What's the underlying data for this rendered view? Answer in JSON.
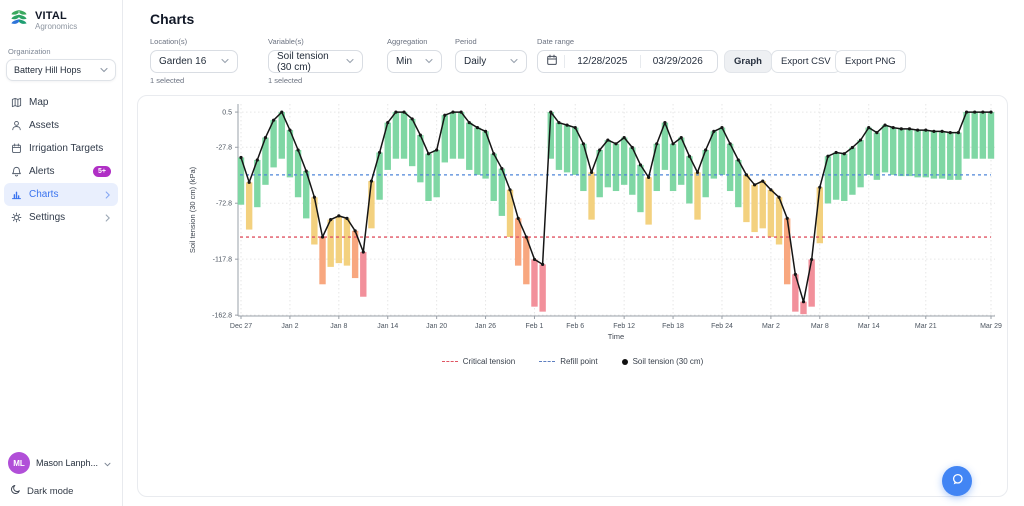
{
  "sidebar": {
    "brand": {
      "name": "VITAL",
      "tagline": "Agronomics"
    },
    "organization": {
      "label": "Organization",
      "selected": "Battery Hill Hops"
    },
    "nav": [
      {
        "label": "Map",
        "icon": "map-icon"
      },
      {
        "label": "Assets",
        "icon": "user-icon"
      },
      {
        "label": "Irrigation Targets",
        "icon": "calendar-icon"
      },
      {
        "label": "Alerts",
        "icon": "bell-icon",
        "badge": "5+"
      },
      {
        "label": "Charts",
        "icon": "bar-chart-icon",
        "active": true
      },
      {
        "label": "Settings",
        "icon": "gear-icon"
      }
    ],
    "user": {
      "initials": "ML",
      "name": "Mason Lanph..."
    },
    "dark_mode_label": "Dark mode"
  },
  "header": {
    "title": "Charts"
  },
  "filters": {
    "location": {
      "label": "Location(s)",
      "value": "Garden 16",
      "hint": "1 selected"
    },
    "variable": {
      "label": "Variable(s)",
      "value": "Soil tension (30 cm)",
      "hint": "1 selected"
    },
    "aggregation": {
      "label": "Aggregation",
      "value": "Min"
    },
    "period": {
      "label": "Period",
      "value": "Daily"
    },
    "date_range": {
      "label": "Date range",
      "start": "12/28/2025",
      "end": "03/29/2026"
    },
    "buttons": {
      "graph": "Graph",
      "export_csv": "Export CSV",
      "export_png": "Export PNG"
    }
  },
  "chart_data": {
    "type": "bar+line",
    "title": "",
    "xlabel": "Time",
    "ylabel": "Soil tension (30 cm)  (kPa)",
    "series_label": "Soil tension (30 cm)",
    "n_days": 93,
    "ylim": [
      7,
      -163.5
    ],
    "y_ticks": [
      {
        "v": 0.5,
        "label": "0.5"
      },
      {
        "v": -27.8,
        "label": "-27.8"
      },
      {
        "v": -72.8,
        "label": "-72.8"
      },
      {
        "v": -117.8,
        "label": "-117.8"
      },
      {
        "v": -162.8,
        "label": "-162.8"
      }
    ],
    "x_ticks": [
      {
        "i": 0,
        "label": "Dec 27"
      },
      {
        "i": 6,
        "label": "Jan 2"
      },
      {
        "i": 12,
        "label": "Jan 8"
      },
      {
        "i": 18,
        "label": "Jan 14"
      },
      {
        "i": 24,
        "label": "Jan 20"
      },
      {
        "i": 30,
        "label": "Jan 26"
      },
      {
        "i": 36,
        "label": "Feb 1"
      },
      {
        "i": 41,
        "label": "Feb 6"
      },
      {
        "i": 47,
        "label": "Feb 12"
      },
      {
        "i": 53,
        "label": "Feb 18"
      },
      {
        "i": 59,
        "label": "Feb 24"
      },
      {
        "i": 65,
        "label": "Mar 2"
      },
      {
        "i": 71,
        "label": "Mar 8"
      },
      {
        "i": 77,
        "label": "Mar 14"
      },
      {
        "i": 84,
        "label": "Mar 21"
      },
      {
        "i": 92,
        "label": "Mar 29"
      }
    ],
    "line_values": [
      -36,
      -56,
      -38,
      -20,
      -6,
      0.5,
      -14,
      -30,
      -47,
      -68,
      -100,
      -86,
      -83,
      -85,
      -95,
      -112,
      -55,
      -32,
      -8,
      0.5,
      0.5,
      -5,
      -18,
      -33,
      -30,
      -2,
      0.5,
      0.5,
      -8,
      -12,
      -15,
      -33,
      -45,
      -62,
      -85,
      -100,
      -118,
      -122,
      0.5,
      -8,
      -10,
      -12,
      -25,
      -48,
      -30,
      -22,
      -25,
      -20,
      -28,
      -42,
      -52,
      -25,
      -8,
      -25,
      -20,
      -35,
      -48,
      -30,
      -15,
      -12,
      -25,
      -38,
      -50,
      -58,
      -55,
      -62,
      -68,
      -85,
      -130,
      -152,
      -118,
      -60,
      -35,
      -32,
      -33,
      -28,
      -22,
      -12,
      -16,
      -10,
      -12,
      -13,
      -13,
      -14,
      -14,
      -15,
      -15,
      -16,
      -16,
      0.5,
      0.5,
      0.5,
      0.5
    ],
    "bar_bottoms": [
      -74,
      -94,
      -76,
      -58,
      -44,
      -37,
      -52,
      -68,
      -85,
      -106,
      -138,
      -124,
      -121,
      -123,
      -133,
      -148,
      -93,
      -70,
      -46,
      -37,
      -37,
      -43,
      -56,
      -71,
      -68,
      -40,
      -37,
      -37,
      -46,
      -50,
      -53,
      -71,
      -83,
      -100,
      -123,
      -138,
      -156,
      -160,
      -37,
      -46,
      -48,
      -50,
      -63,
      -86,
      -68,
      -60,
      -63,
      -58,
      -66,
      -80,
      -90,
      -63,
      -46,
      -63,
      -58,
      -73,
      -86,
      -68,
      -53,
      -50,
      -63,
      -76,
      -88,
      -96,
      -93,
      -100,
      -106,
      -138,
      -160,
      -162,
      -156,
      -105,
      -73,
      -70,
      -71,
      -66,
      -60,
      -50,
      -54,
      -48,
      -50,
      -51,
      -51,
      -52,
      -52,
      -53,
      -53,
      -54,
      -54,
      -37,
      -37,
      -37,
      -37
    ],
    "bar_colors": [
      "g",
      "y",
      "g",
      "g",
      "g",
      "g",
      "g",
      "g",
      "g",
      "y",
      "o",
      "y",
      "y",
      "y",
      "o",
      "r",
      "y",
      "g",
      "g",
      "g",
      "g",
      "g",
      "g",
      "g",
      "g",
      "g",
      "g",
      "g",
      "g",
      "g",
      "g",
      "g",
      "g",
      "y",
      "o",
      "o",
      "r",
      "r",
      "g",
      "g",
      "g",
      "g",
      "g",
      "y",
      "g",
      "g",
      "g",
      "g",
      "g",
      "g",
      "y",
      "g",
      "g",
      "g",
      "g",
      "g",
      "y",
      "g",
      "g",
      "g",
      "g",
      "g",
      "y",
      "y",
      "y",
      "y",
      "y",
      "o",
      "r",
      "r",
      "r",
      "y",
      "g",
      "g",
      "g",
      "g",
      "g",
      "g",
      "g",
      "g",
      "g",
      "g",
      "g",
      "g",
      "g",
      "g",
      "g",
      "g",
      "g",
      "g",
      "g",
      "g",
      "g"
    ],
    "palette": {
      "g": "#7fd7a4",
      "y": "#f3d17f",
      "o": "#f8a77f",
      "r": "#f2909b",
      "line": "#151515"
    },
    "ref_lines": [
      {
        "name": "Refill point",
        "value": -50,
        "color": "#4e86d8"
      },
      {
        "name": "Critical tension",
        "value": -100,
        "color": "#e05563"
      }
    ],
    "legend": [
      {
        "label": "Critical tension",
        "swatch": "dash-red"
      },
      {
        "label": "Refill point",
        "swatch": "dash-blue"
      },
      {
        "label": "Soil tension (30 cm)",
        "swatch": "dot-black"
      }
    ]
  }
}
